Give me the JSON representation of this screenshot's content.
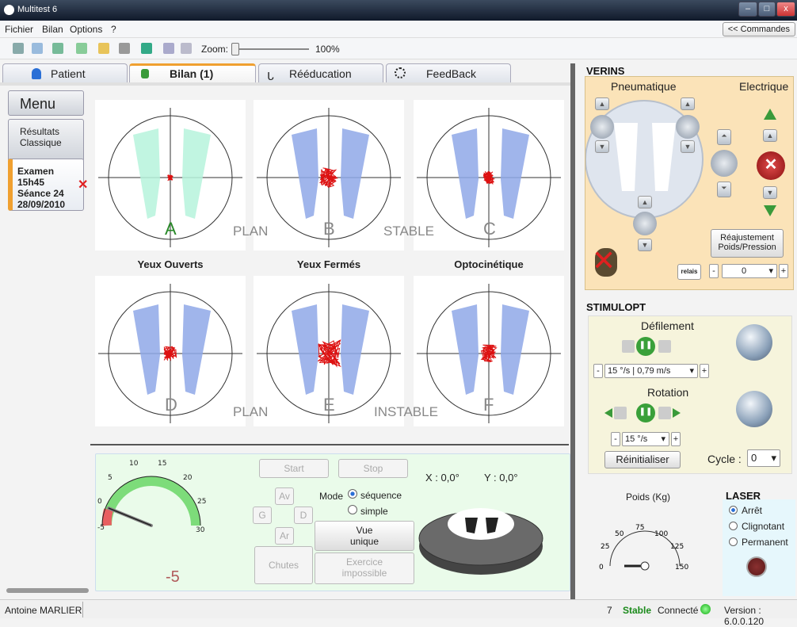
{
  "window": {
    "title": "Multitest 6",
    "minimize": "–",
    "maximize": "□",
    "close": "x"
  },
  "menu": {
    "items": [
      "Fichier",
      "Bilan",
      "Options",
      "?"
    ],
    "commande_label": "<< Commandes"
  },
  "toolbar": {
    "zoom_label": "Zoom:",
    "zoom_value": "100%"
  },
  "tabs": [
    {
      "label": "Patient"
    },
    {
      "label": "Bilan (1)",
      "active": true
    },
    {
      "label": "Rééducation"
    },
    {
      "label": "FeedBack"
    }
  ],
  "leftnav": {
    "menu": "Menu",
    "resultats_l1": "Résultats",
    "resultats_l2": "Classique",
    "exam_l1": "Examen 15h45",
    "exam_l2": "Séance 24",
    "exam_l3": "28/09/2010"
  },
  "panels": {
    "top_letters": [
      "A",
      "B",
      "C"
    ],
    "bottom_letters": [
      "D",
      "E",
      "F"
    ],
    "top_plan": "PLAN",
    "top_state": "STABLE",
    "bottom_plan": "PLAN",
    "bottom_state": "INSTABLE",
    "captions": [
      "Yeux Ouverts",
      "Yeux Fermés",
      "Optocinétique"
    ]
  },
  "control": {
    "gauge_ticks": [
      "-5",
      "0",
      "5",
      "10",
      "15",
      "20",
      "25",
      "30"
    ],
    "gauge_value": "-5",
    "gauge_level": -5,
    "start": "Start",
    "stop": "Stop",
    "av": "Av",
    "g": "G",
    "d": "D",
    "ar": "Ar",
    "chutes": "Chutes",
    "mode_label": "Mode",
    "mode_sequence": "séquence",
    "mode_simple": "simple",
    "mode_selected": "séquence",
    "vue_l1": "Vue",
    "vue_l2": "unique",
    "exercice_l1": "Exercice",
    "exercice_l2": "impossible",
    "x_readout": "X : 0,0°",
    "y_readout": "Y : 0,0°"
  },
  "verins": {
    "title": "VERINS",
    "pneumatique": "Pneumatique",
    "electrique": "Electrique",
    "reajust_l1": "Réajustement",
    "reajust_l2": "Poids/Pression",
    "relais": "relais",
    "value": "0",
    "minus": "-",
    "plus": "+"
  },
  "stimulopt": {
    "title": "STIMULOPT",
    "defilement": "Défilement",
    "def_value": "15 °/s | 0,79 m/s",
    "rotation": "Rotation",
    "rot_value": "15 °/s",
    "reinit": "Réinitialiser",
    "cycle_label": "Cycle :",
    "cycle_value": "0",
    "minus": "-",
    "plus": "+"
  },
  "poids": {
    "label": "Poids (Kg)",
    "ticks": [
      "0",
      "25",
      "50",
      "75",
      "100",
      "125",
      "150"
    ]
  },
  "laser": {
    "title": "LASER",
    "options": [
      "Arrêt",
      "Clignotant",
      "Permanent"
    ],
    "selected": "Arrêt"
  },
  "status": {
    "user": "Antoine MARLIER",
    "count": "7",
    "stable": "Stable",
    "connecte": "Connecté",
    "version": "Version : 6.0.0.120"
  },
  "colors": {
    "accent_tab": "#f0a030",
    "trace": "#dd1111",
    "foot_blue": "#8fa8e8",
    "foot_green": "#9ff0d0",
    "gauge_green": "#7ddc7a",
    "gauge_red": "#e86060"
  }
}
